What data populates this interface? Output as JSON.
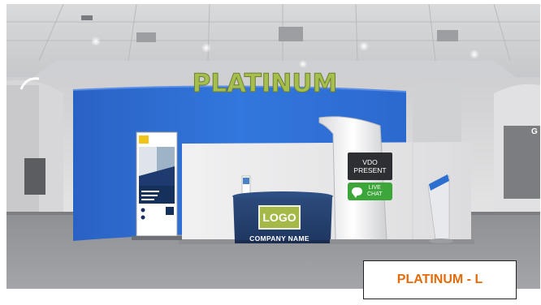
{
  "booth": {
    "tier_sign": "PLATINUM",
    "counter_logo": "LOGO",
    "company_name": "COMPANY NAME",
    "video_button": {
      "line1": "VDO",
      "line2": "PRESENT"
    },
    "chat_button": {
      "line1": "LIVE",
      "line2": "CHAT",
      "icon": "chat-bubble-icon"
    }
  },
  "caption": {
    "label": "PLATINUM - L"
  },
  "colors": {
    "wall_blue": "#2f6fd8",
    "sign_green": "#a4bf4d",
    "logo_green": "#a4b948",
    "chat_green": "#3da63a",
    "counter_navy": "#27426f",
    "caption_orange": "#e46c0a"
  }
}
